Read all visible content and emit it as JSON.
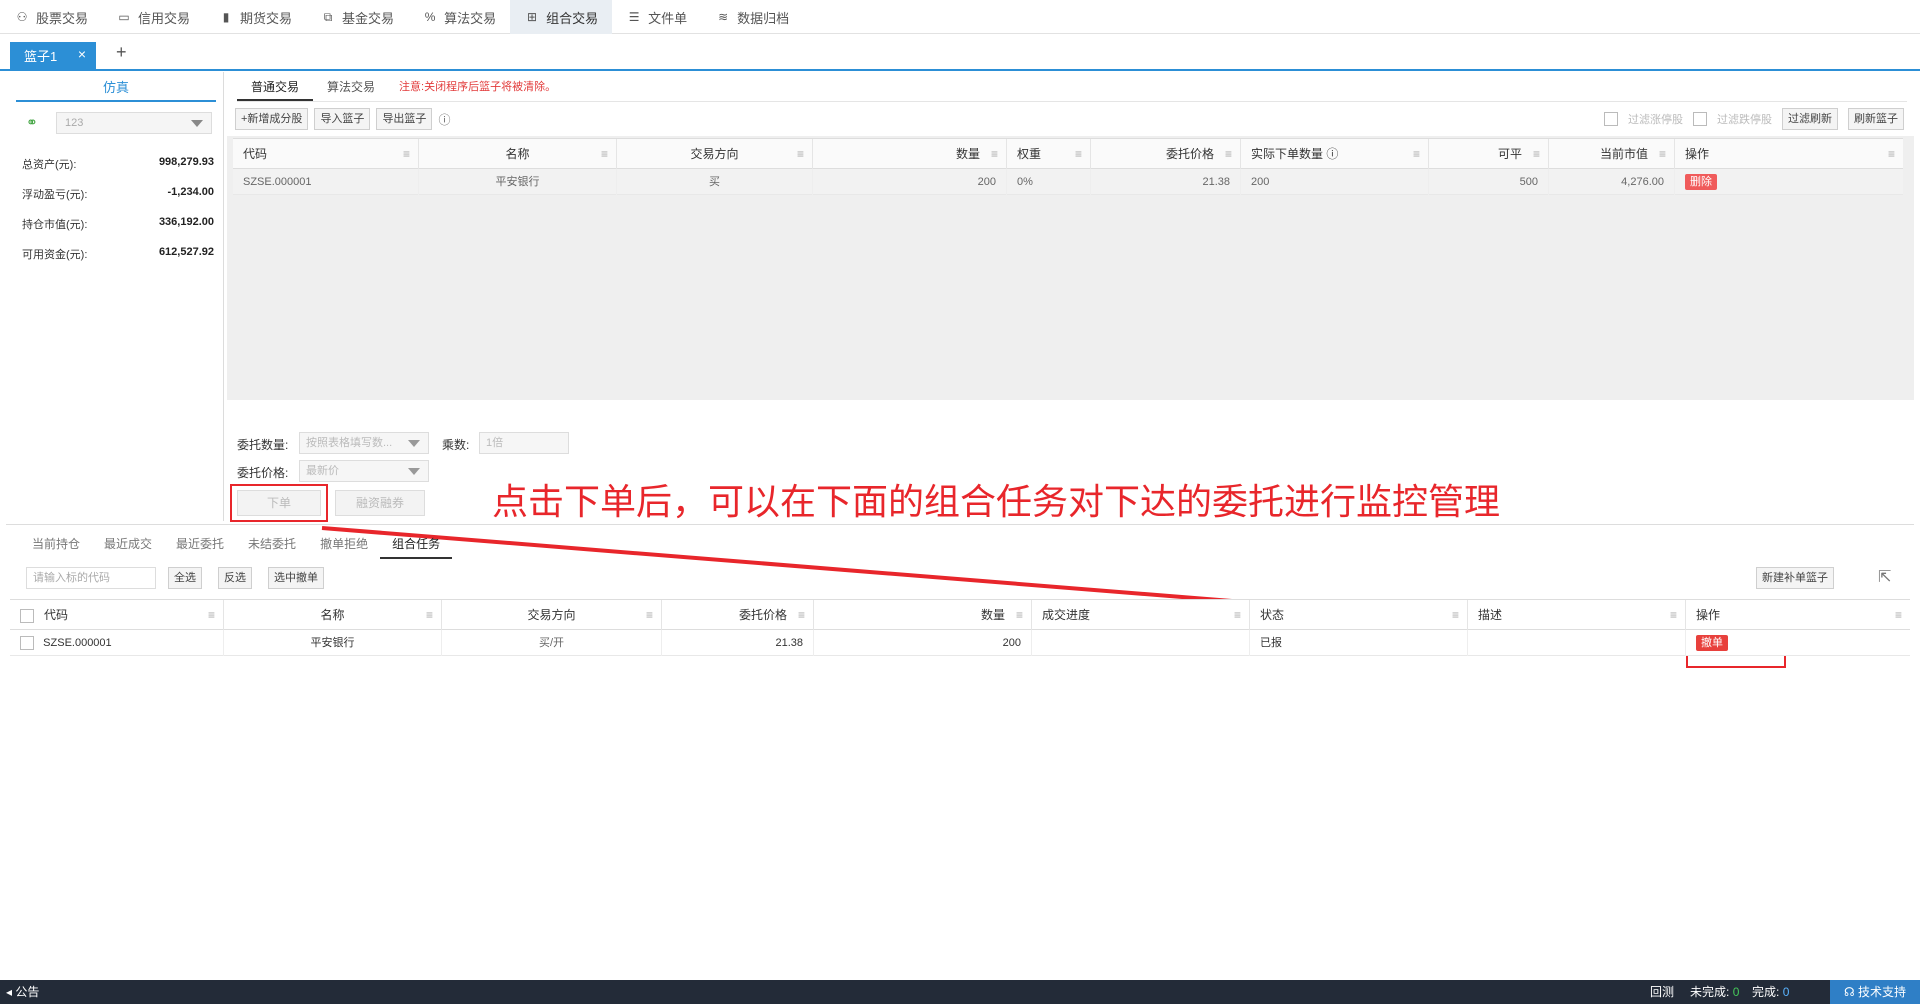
{
  "nav": {
    "items": [
      {
        "label": "股票交易",
        "icon": "stock-icon"
      },
      {
        "label": "信用交易",
        "icon": "credit-card-icon"
      },
      {
        "label": "期货交易",
        "icon": "bar-chart-icon"
      },
      {
        "label": "基金交易",
        "icon": "line-chart-icon"
      },
      {
        "label": "算法交易",
        "icon": "percent-icon"
      },
      {
        "label": "组合交易",
        "icon": "basket-icon"
      },
      {
        "label": "文件单",
        "icon": "document-icon"
      },
      {
        "label": "数据归档",
        "icon": "layers-icon"
      }
    ]
  },
  "basket_tab": {
    "label": "篮子1",
    "close": "×",
    "add": "+"
  },
  "left": {
    "title": "仿真",
    "account": "123",
    "rows": [
      {
        "label": "总资产(元):",
        "value": "998,279.93"
      },
      {
        "label": "浮动盈亏(元):",
        "value": "-1,234.00"
      },
      {
        "label": "持仓市值(元):",
        "value": "336,192.00"
      },
      {
        "label": "可用资金(元):",
        "value": "612,527.92"
      }
    ]
  },
  "main": {
    "tabs": [
      "普通交易",
      "算法交易"
    ],
    "notice": "注意:关闭程序后篮子将被清除。",
    "toolbar": [
      "+新增成分股",
      "导入篮子",
      "导出篮子"
    ],
    "filter_limit_up": "过滤涨停股",
    "filter_limit_down": "过滤跌停股",
    "filter_refresh": "过滤刷新",
    "refresh_basket": "刷新篮子",
    "columns": [
      "代码",
      "名称",
      "交易方向",
      "数量",
      "权重",
      "委托价格",
      "实际下单数量",
      "可平",
      "当前市值",
      "操作"
    ],
    "rows": [
      {
        "code": "SZSE.000001",
        "name": "平安银行",
        "direction": "买",
        "qty": "200",
        "weight": "0%",
        "price": "21.38",
        "actual_qty": "200",
        "closable": "500",
        "market_value": "4,276.00",
        "action": "删除"
      }
    ],
    "form": {
      "qty_label": "委托数量:",
      "qty_placeholder": "按照表格填写数...",
      "multiplier_label": "乘数:",
      "multiplier_placeholder": "1倍",
      "price_label": "委托价格:",
      "price_value": "最新价",
      "order_button": "下单",
      "margin_button": "融资融券"
    }
  },
  "annotation": "点击下单后，可以在下面的组合任务对下达的委托进行监控管理",
  "bottom": {
    "tabs": [
      "当前持仓",
      "最近成交",
      "最近委托",
      "未结委托",
      "撤单拒绝",
      "组合任务"
    ],
    "search_placeholder": "请输入标的代码",
    "buttons": [
      "全选",
      "反选",
      "选中撤单"
    ],
    "new_supplement": "新建补单篮子",
    "columns": [
      "代码",
      "名称",
      "交易方向",
      "委托价格",
      "数量",
      "成交进度",
      "状态",
      "描述",
      "操作"
    ],
    "rows": [
      {
        "code": "SZSE.000001",
        "name": "平安银行",
        "direction": "买/开",
        "price": "21.38",
        "qty": "200",
        "progress": "",
        "status": "已报",
        "desc": "",
        "action": "撤单"
      }
    ]
  },
  "status": {
    "notice": "公告",
    "backtest": "回测",
    "incomplete_label": "未完成:",
    "incomplete_value": "0",
    "complete_label": "完成:",
    "complete_value": "0",
    "support": "技术支持"
  },
  "colors": {
    "accent": "#2c8fd6",
    "annotation": "#e8262b",
    "status_bar": "#232b38"
  }
}
